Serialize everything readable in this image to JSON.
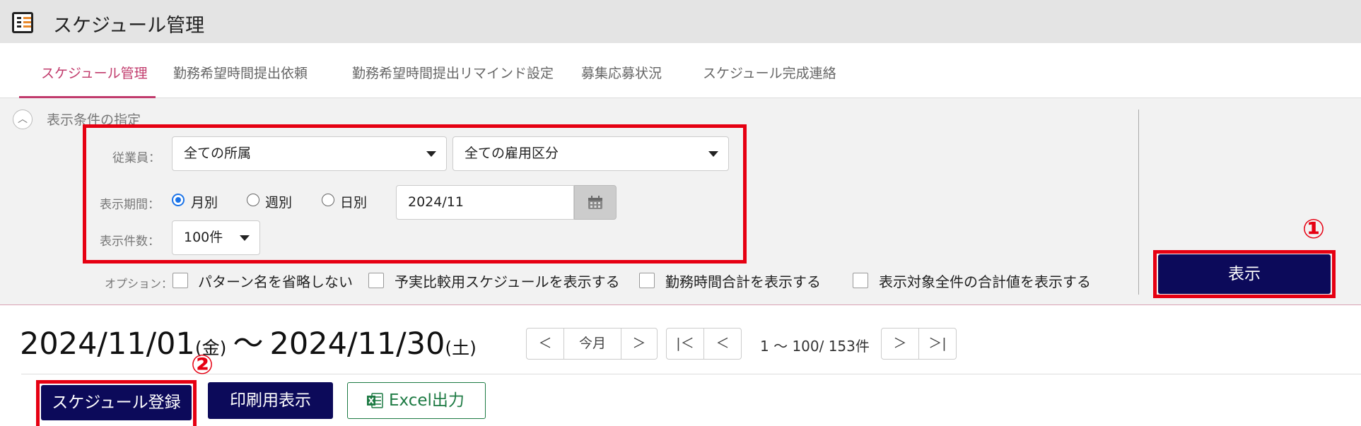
{
  "app": {
    "title": "スケジュール管理",
    "icon": "schedule-list-icon"
  },
  "tabs": [
    {
      "label": "スケジュール管理",
      "active": true
    },
    {
      "label": "勤務希望時間提出依頼",
      "active": false
    },
    {
      "label": "勤務希望時間提出リマインド設定",
      "active": false
    },
    {
      "label": "募集応募状況",
      "active": false
    },
    {
      "label": "スケジュール完成連絡",
      "active": false
    }
  ],
  "filter": {
    "section_title": "表示条件の指定",
    "employee_label": "従業員：",
    "affiliation_value": "全ての所属",
    "employment_type_value": "全ての雇用区分",
    "period_label": "表示期間：",
    "period_options": [
      "月別",
      "週別",
      "日別"
    ],
    "period_selected": "月別",
    "date_value": "2024/11",
    "count_label": "表示件数：",
    "count_value": "100件",
    "options_label": "オプション：",
    "options": [
      {
        "label": "パターン名を省略しない",
        "checked": false
      },
      {
        "label": "予実比較用スケジュールを表示する",
        "checked": false
      },
      {
        "label": "勤務時間合計を表示する",
        "checked": false
      },
      {
        "label": "表示対象全件の合計値を表示する",
        "checked": false
      }
    ],
    "show_button": "表示"
  },
  "annotations": {
    "marker_1": "①",
    "marker_2": "②"
  },
  "range": {
    "start_date": "2024/11/01",
    "start_dow": "(金)",
    "tilde": "〜",
    "end_date": "2024/11/30",
    "end_dow": "(土)"
  },
  "pager": {
    "this_month": "今月",
    "prev": "＜",
    "next": "＞",
    "first": "|＜",
    "last": "＞|",
    "info": "1 ～ 100/ 153件"
  },
  "actions": {
    "register": "スケジュール登録",
    "print": "印刷用表示",
    "excel": "Excel出力"
  },
  "colors": {
    "accent": "#c13b6c",
    "navy": "#0c0a5a",
    "highlight": "#e60012",
    "excel_green": "#1d7a43"
  }
}
